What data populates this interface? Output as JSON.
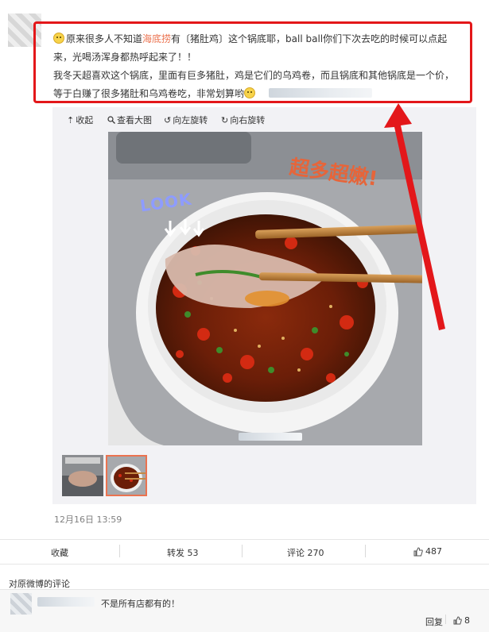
{
  "post": {
    "line1_parts": [
      "原来很多人不知道",
      "海底捞",
      "有〔猪肚鸡〕这个锅底耶，ball ball你们下次去吃的时候可以点起"
    ],
    "line2": "来，光喝汤浑身都热呼起来了！！",
    "line3": "我冬天超喜欢这个锅底，里面有巨多猪肚，鸡是它们的乌鸡卷，而且锅底和其他锅底是一个价，",
    "line4": "等于白赚了很多猪肚和乌鸡卷吃，非常划算哟",
    "emoji_names": [
      "hungry-emoji",
      "laugh-emoji"
    ],
    "highlight_color": "#eb7350"
  },
  "media_toolbar": {
    "collapse_label": "收起",
    "view_large_label": "查看大图",
    "rotate_left_label": "向左旋转",
    "rotate_right_label": "向右旋转"
  },
  "photo": {
    "handwritten_right": "超多超嫩!",
    "handwritten_left": "LOOK"
  },
  "timestamp": "12月16日 13:59",
  "actions": {
    "favorite_label": "收藏",
    "repost_label": "转发 53",
    "comment_label": "评论 270",
    "like_count": "487"
  },
  "comments": {
    "title": "对原微博的评论",
    "items": [
      {
        "text": "不是所有店都有的！",
        "reply_label": "回复",
        "like_count": "8"
      }
    ]
  },
  "annotation_color": "#e3171a"
}
